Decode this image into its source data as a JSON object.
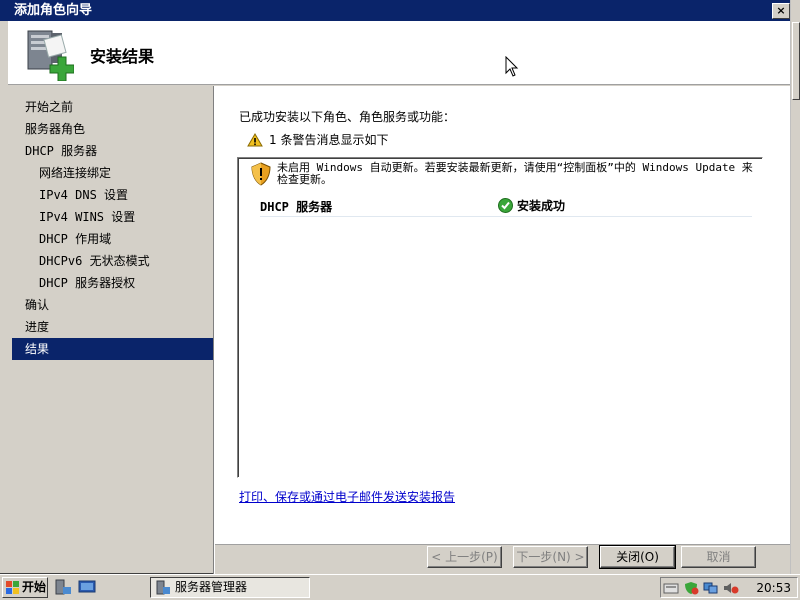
{
  "window": {
    "title": "添加角色向导",
    "close_label": "×"
  },
  "header": {
    "title": "安装结果",
    "icon": "server-add-icon"
  },
  "nav": {
    "items": [
      {
        "label": "开始之前",
        "level": 0
      },
      {
        "label": "服务器角色",
        "level": 0
      },
      {
        "label": "DHCP 服务器",
        "level": 0
      },
      {
        "label": "网络连接绑定",
        "level": 1
      },
      {
        "label": "IPv4 DNS 设置",
        "level": 1
      },
      {
        "label": "IPv4 WINS 设置",
        "level": 1
      },
      {
        "label": "DHCP 作用域",
        "level": 1
      },
      {
        "label": "DHCPv6 无状态模式",
        "level": 1
      },
      {
        "label": "DHCP 服务器授权",
        "level": 1
      },
      {
        "label": "确认",
        "level": 0
      },
      {
        "label": "进度",
        "level": 0
      },
      {
        "label": "结果",
        "level": 0,
        "selected": true
      }
    ]
  },
  "content": {
    "heading": "已成功安装以下角色、角色服务或功能：",
    "warning_summary": "1 条警告消息显示如下",
    "results": {
      "warning_message": "未启用 Windows 自动更新。若要安装最新更新，请使用“控制面板”中的 Windows Update 来检查更新。",
      "role_name": "DHCP 服务器",
      "role_status": "安装成功"
    },
    "report_link": "打印、保存或通过电子邮件发送安装报告"
  },
  "buttons": {
    "previous": "< 上一步(P)",
    "next": "下一步(N) >",
    "close": "关闭(O)",
    "cancel": "取消"
  },
  "taskbar": {
    "start_label": "开始",
    "task_label": "服务器管理器",
    "clock": "20:53"
  },
  "colors": {
    "selection": "#0a246a",
    "link": "#0000cc",
    "success": "#3aa63a",
    "warning": "#f0c020"
  }
}
